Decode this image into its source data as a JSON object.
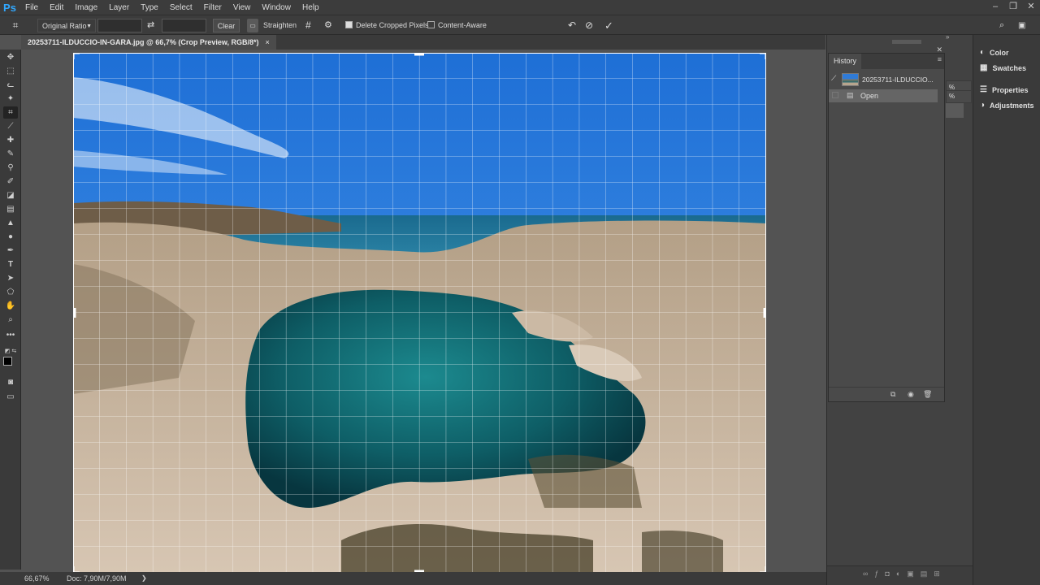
{
  "app": {
    "logo": "Ps"
  },
  "menu": [
    "File",
    "Edit",
    "Image",
    "Layer",
    "Type",
    "Select",
    "Filter",
    "View",
    "Window",
    "Help"
  ],
  "options": {
    "ratio_value": "Original Ratio",
    "clear_label": "Clear",
    "straighten_label": "Straighten",
    "delete_cropped_label": "Delete Cropped Pixels",
    "delete_cropped_checked": true,
    "content_aware_label": "Content-Aware",
    "content_aware_checked": false
  },
  "document": {
    "tab_title": "20253711-ILDUCCIO-IN-GARA.jpg @ 66,7% (Crop Preview, RGB/8*)",
    "close_glyph": "×"
  },
  "status": {
    "zoom": "66,67%",
    "doc_info": "Doc: 7,90M/7,90M",
    "arrow": "❯"
  },
  "history": {
    "title": "History",
    "snapshot_label": "20253711-ILDUCCIO...",
    "steps": [
      "Open"
    ]
  },
  "mid_panel": {
    "pct1": "%",
    "pct2": "%"
  },
  "right_panel": {
    "items": [
      "Color",
      "Swatches",
      "Properties",
      "Adjustments"
    ]
  },
  "colors": {
    "accent": "#31a8ff",
    "ui_dark": "#3c3c3c",
    "canvas_bg": "#535353"
  }
}
